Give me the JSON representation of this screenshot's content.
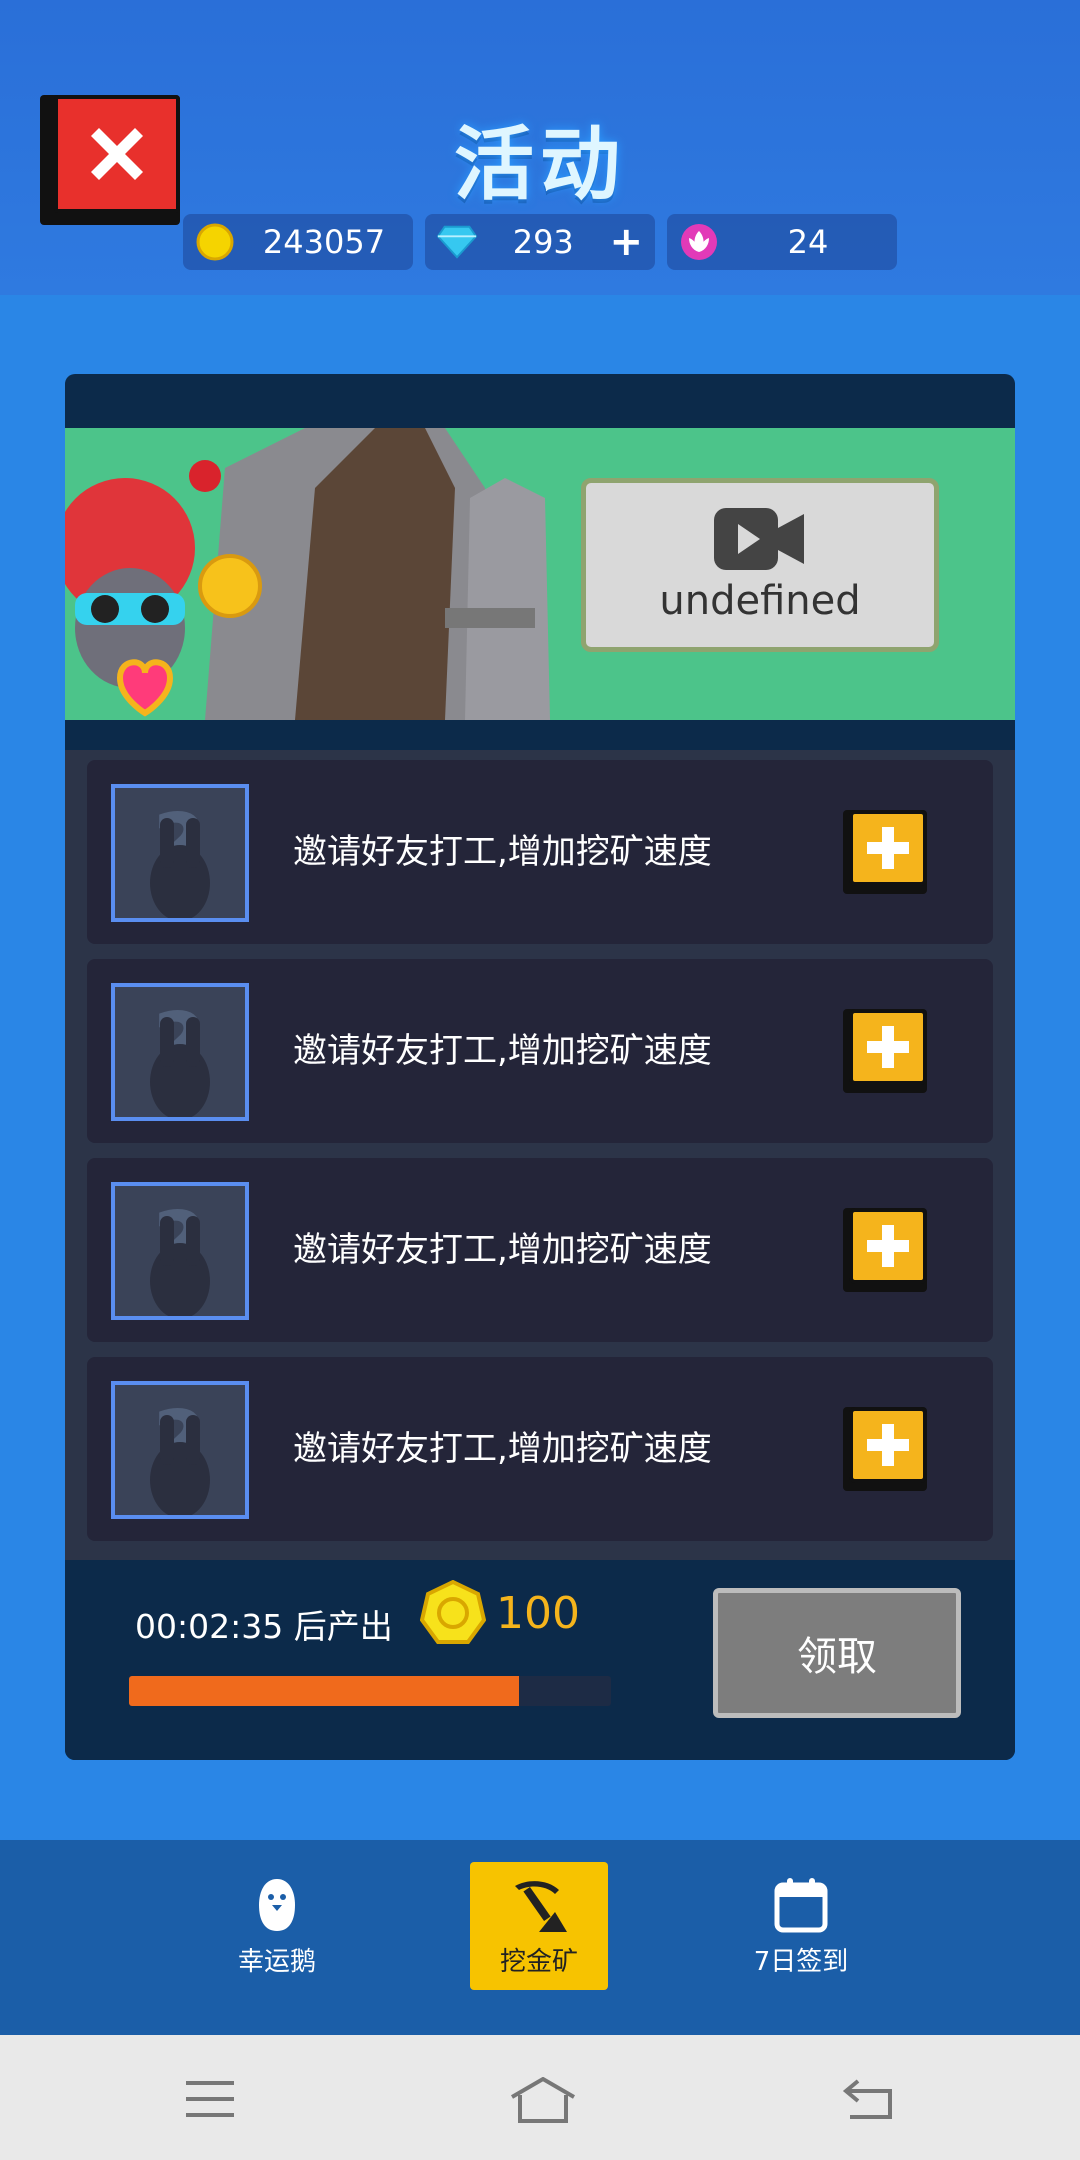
{
  "header": {
    "title": "活动",
    "currencies": [
      {
        "name": "coins",
        "value": "243057"
      },
      {
        "name": "diamonds",
        "value": "293",
        "plus": "+"
      },
      {
        "name": "lotus",
        "value": "24"
      }
    ]
  },
  "banner": {
    "video_button_label": "undefined"
  },
  "tasks": [
    {
      "text": "邀请好友打工,增加挖矿速度"
    },
    {
      "text": "邀请好友打工,增加挖矿速度"
    },
    {
      "text": "邀请好友打工,增加挖矿速度"
    },
    {
      "text": "邀请好友打工,增加挖矿速度"
    }
  ],
  "footer": {
    "timer_text": "00:02:35 后产出",
    "reward_amount": "100",
    "progress_fraction": 0.81,
    "claim_label": "领取"
  },
  "bottom_nav": {
    "items": [
      {
        "label": "幸运鹅",
        "icon": "goose-icon"
      },
      {
        "label": "挖金矿",
        "icon": "pickaxe-icon",
        "active": true
      },
      {
        "label": "7日签到",
        "icon": "calendar-icon"
      }
    ]
  },
  "colors": {
    "accent_yellow": "#f5b41c",
    "progress_orange": "#f06a1c",
    "close_red": "#e8302c",
    "background_blue": "#2a86e6"
  }
}
